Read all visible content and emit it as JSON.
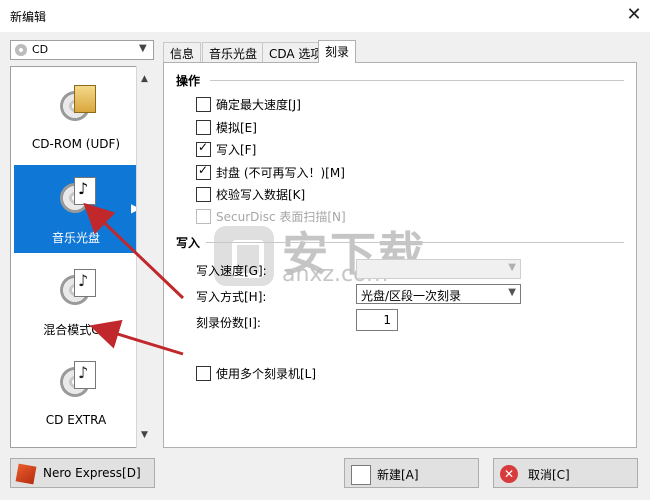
{
  "window": {
    "title": "新编辑",
    "close_glyph": "✕"
  },
  "drive": {
    "label": "CD"
  },
  "left_list": {
    "items": [
      {
        "label": "CD-ROM (UDF)",
        "icon": "cd-rom-udf-icon"
      },
      {
        "label": "音乐光盘",
        "icon": "music-disc-icon",
        "selected": true
      },
      {
        "label": "混合模式CD",
        "icon": "mixed-mode-cd-icon"
      },
      {
        "label": "CD EXTRA",
        "icon": "cd-extra-icon"
      }
    ]
  },
  "tabs": [
    {
      "label": "信息"
    },
    {
      "label": "音乐光盘"
    },
    {
      "label": "CDA 选项"
    },
    {
      "label": "刻录",
      "active": true
    }
  ],
  "operations": {
    "heading": "操作",
    "options": [
      {
        "label": "确定最大速度[J]",
        "checked": false,
        "disabled": false
      },
      {
        "label": "模拟[E]",
        "checked": false,
        "disabled": false
      },
      {
        "label": "写入[F]",
        "checked": true,
        "disabled": false
      },
      {
        "label": "封盘 (不可再写入！)[M]",
        "checked": true,
        "disabled": false
      },
      {
        "label": "校验写入数据[K]",
        "checked": false,
        "disabled": false
      },
      {
        "label": "SecurDisc 表面扫描[N]",
        "checked": false,
        "disabled": true
      }
    ]
  },
  "write": {
    "heading": "写入",
    "speed_label": "写入速度[G]:",
    "speed_value": "",
    "method_label": "写入方式[H]:",
    "method_value": "光盘/区段一次刻录",
    "copies_label": "刻录份数[I]:",
    "copies_value": "1",
    "multi_burner_label": "使用多个刻录机[L]",
    "multi_burner_checked": false
  },
  "watermark": {
    "big": "安下载",
    "small": "anxz.com"
  },
  "buttons": {
    "nero_express": "Nero Express[D]",
    "new": "新建[A]",
    "cancel": "取消[C]",
    "cancel_glyph": "✕"
  },
  "colors": {
    "selection": "#0f78d7",
    "annotation_arrow": "#c0282b"
  }
}
